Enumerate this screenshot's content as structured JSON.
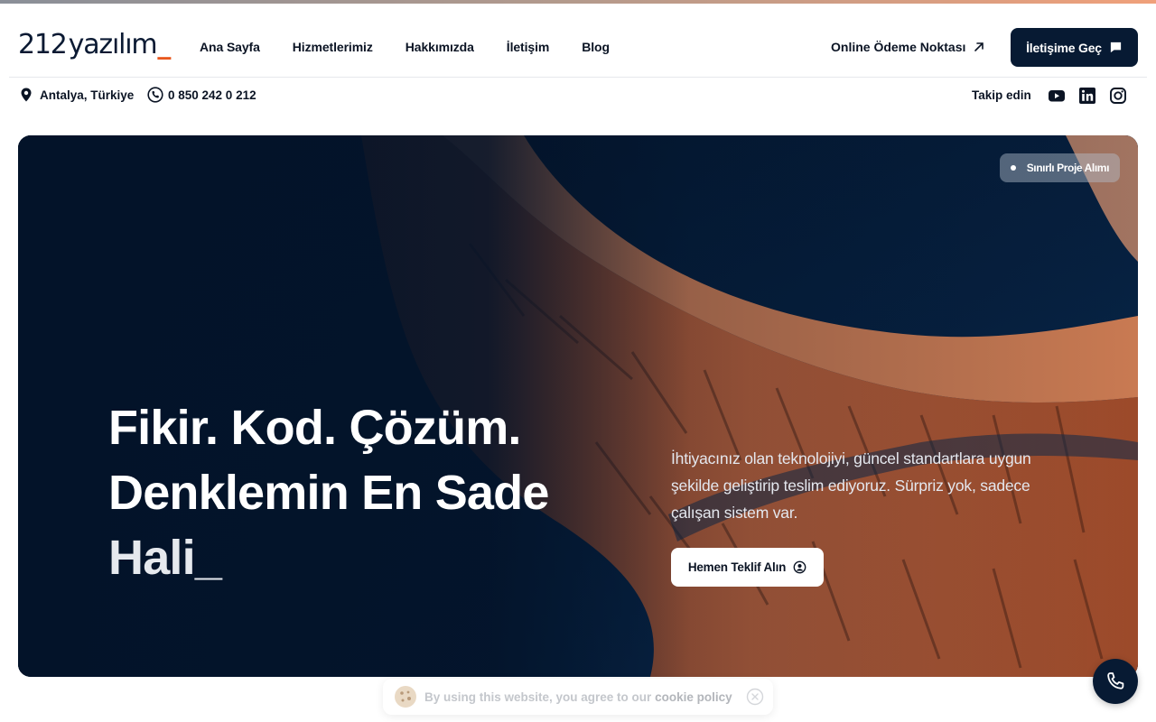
{
  "logo": {
    "number": "212",
    "word": "yazılım",
    "underscore": "_"
  },
  "nav": {
    "items": [
      {
        "label": "Ana Sayfa"
      },
      {
        "label": "Hizmetlerimiz"
      },
      {
        "label": "Hakkımızda"
      },
      {
        "label": "İletişim"
      },
      {
        "label": "Blog"
      }
    ],
    "payment_link": "Online Ödeme Noktası",
    "cta_label": "İletişime Geç"
  },
  "infobar": {
    "location": "Antalya, Türkiye",
    "phone": "0 850 242 0 212",
    "follow_label": "Takip edin",
    "social_icons": [
      "youtube-icon",
      "linkedin-icon",
      "instagram-icon"
    ]
  },
  "hero": {
    "badge": "Sınırlı Proje Alımı",
    "title_lines": [
      "Fikir. Kod. Çözüm.",
      "Denklemin En Sade",
      "Hali_"
    ],
    "description": "İhtiyacınız olan teknolojiyi, güncel standartlara uygun şekilde geliştirip teslim ediyoruz. Sürpriz yok, sadece çalışan sistem var.",
    "button_label": "Hemen Teklif Alın"
  },
  "cookie": {
    "text": "By using this website, you agree to our",
    "policy_link": "cookie policy"
  },
  "colors": {
    "navy": "#071a33",
    "accent_orange": "#e8571e",
    "hero_bg": "#04162c",
    "terrain": "#b9613a"
  }
}
